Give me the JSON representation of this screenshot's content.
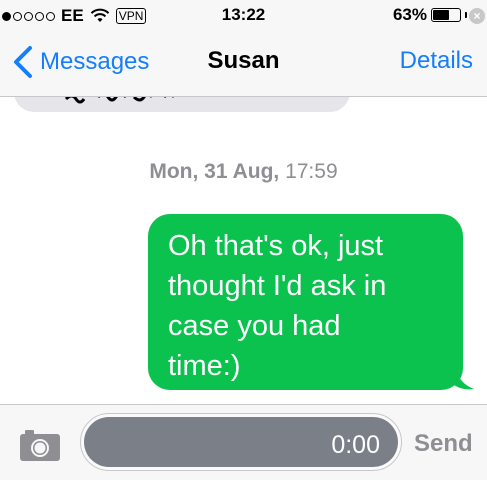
{
  "status_bar": {
    "carrier": "EE",
    "vpn": "VPN",
    "time": "13:22",
    "battery_text": "63%",
    "battery_level": 0.63,
    "signal_bars_filled": 1,
    "signal_bars_total": 5
  },
  "nav": {
    "back_label": "Messages",
    "title": "Susan",
    "details_label": "Details"
  },
  "conversation": {
    "timestamp_day": "Mon, 31 Aug,",
    "timestamp_time": "17:59",
    "messages": [
      {
        "direction": "sent",
        "lines": [
          "Oh that's ok, just",
          "thought I'd ask in",
          "case you had",
          "time:)"
        ]
      }
    ]
  },
  "input": {
    "audio_time": "0:00",
    "send_label": "Send"
  },
  "colors": {
    "accent": "#147efb",
    "sent_bubble": "#0cc24f",
    "received_bubble": "#e5e5ea",
    "timestamp": "#8e8e93"
  }
}
